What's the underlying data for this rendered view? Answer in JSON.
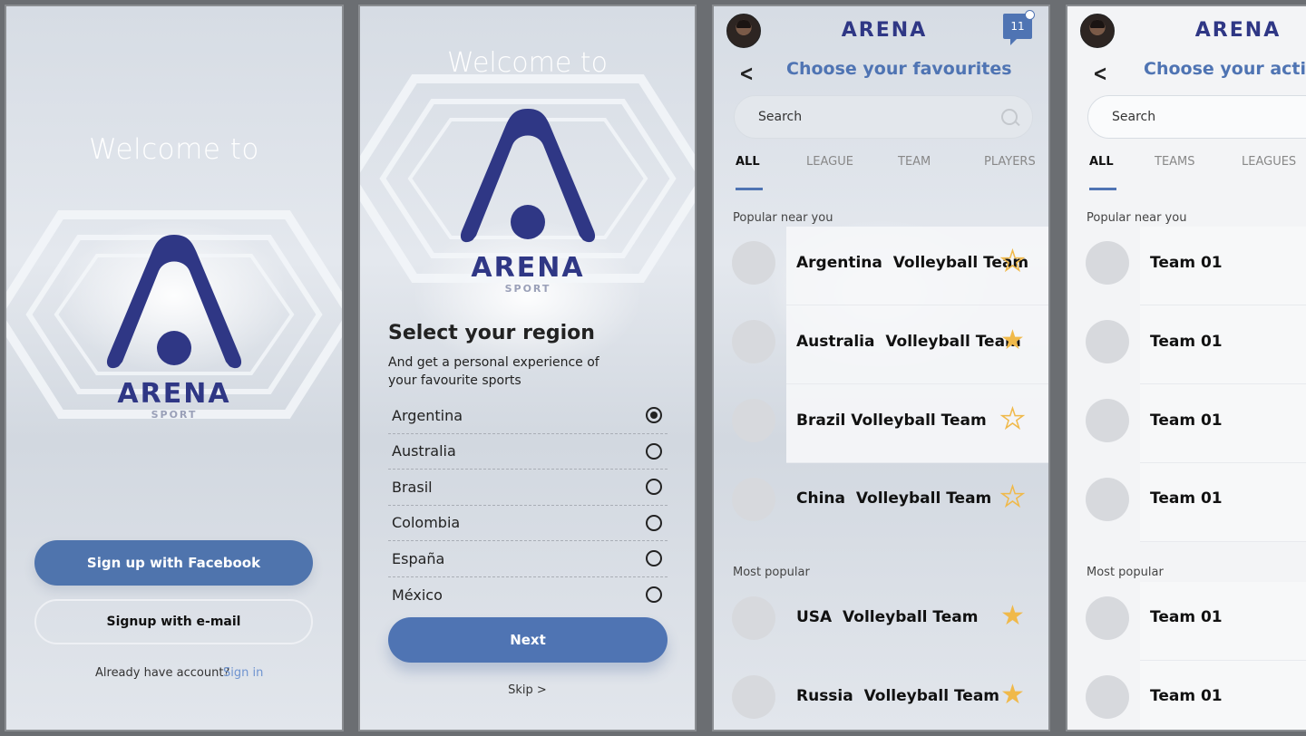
{
  "brand": {
    "name": "ARENA",
    "sub": "SPORT",
    "logo_color": "#2f3785",
    "accent": "#4f74b3",
    "star_color": "#f0b94a"
  },
  "s1": {
    "welcome": "Welcome to",
    "fb_button": "Sign up with Facebook",
    "email_button": "Signup with e-mail",
    "have_account": "Already have account?",
    "signin": "Sign in"
  },
  "s2": {
    "welcome": "Welcome to",
    "title": "Select your region",
    "subtitle": "And get a personal experience of your favourite sports",
    "regions": [
      {
        "name": "Argentina",
        "selected": true
      },
      {
        "name": "Australia",
        "selected": false
      },
      {
        "name": "Brasil",
        "selected": false
      },
      {
        "name": "Colombia",
        "selected": false
      },
      {
        "name": "España",
        "selected": false
      },
      {
        "name": "México",
        "selected": false
      }
    ],
    "next": "Next",
    "skip": "Skip >"
  },
  "s3": {
    "notifications": "11",
    "title": "Choose your favourites",
    "search_placeholder": "Search",
    "tabs": [
      "ALL",
      "LEAGUE",
      "TEAM",
      "PLAYERS"
    ],
    "popular_near": "Popular near you",
    "most_popular": "Most popular",
    "teams": [
      {
        "name": "Argentina  Volleyball Team",
        "favourite": false
      },
      {
        "name": "Australia  Volleyball Team",
        "favourite": true
      },
      {
        "name": "Brazil Volleyball Team",
        "favourite": false
      },
      {
        "name": "China  Volleyball Team",
        "favourite": false
      },
      {
        "name": "USA  Volleyball Team",
        "favourite": true
      },
      {
        "name": "Russia  Volleyball Team",
        "favourite": true
      }
    ]
  },
  "s4": {
    "title": "Choose your activiti",
    "search_placeholder": "Search",
    "tabs": [
      "ALL",
      "TEAMS",
      "LEAGUES"
    ],
    "popular_near": "Popular near you",
    "most_popular": "Most popular",
    "teams": [
      "Team 01",
      "Team 01",
      "Team 01",
      "Team 01",
      "Team 01",
      "Team 01"
    ]
  }
}
